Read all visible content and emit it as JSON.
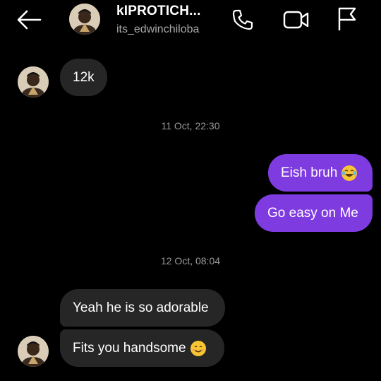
{
  "header": {
    "contact_name": "kIPROTICH...",
    "username": "its_edwinchiloba",
    "icons": {
      "back": "back-arrow-icon",
      "call": "phone-icon",
      "video": "video-camera-icon",
      "report": "flag-icon"
    }
  },
  "messages": [
    {
      "text": "12k",
      "direction": "incoming"
    },
    {
      "timestamp": "11 Oct, 22:30"
    },
    {
      "text": "Eish bruh",
      "direction": "outgoing",
      "emoji": "laughing-tears-emoji"
    },
    {
      "text": "Go easy on Me",
      "direction": "outgoing"
    },
    {
      "timestamp": "12 Oct, 08:04"
    },
    {
      "text": "Yeah he is so adorable",
      "direction": "incoming"
    },
    {
      "text": "Fits you handsome",
      "direction": "incoming",
      "emoji": "smiling-face-emoji"
    }
  ],
  "colors": {
    "background": "#000000",
    "incoming_bubble": "#262626",
    "outgoing_bubble": "#7e3be0",
    "timestamp_text": "#9a9a9a",
    "username_text": "#a8a8a8"
  }
}
